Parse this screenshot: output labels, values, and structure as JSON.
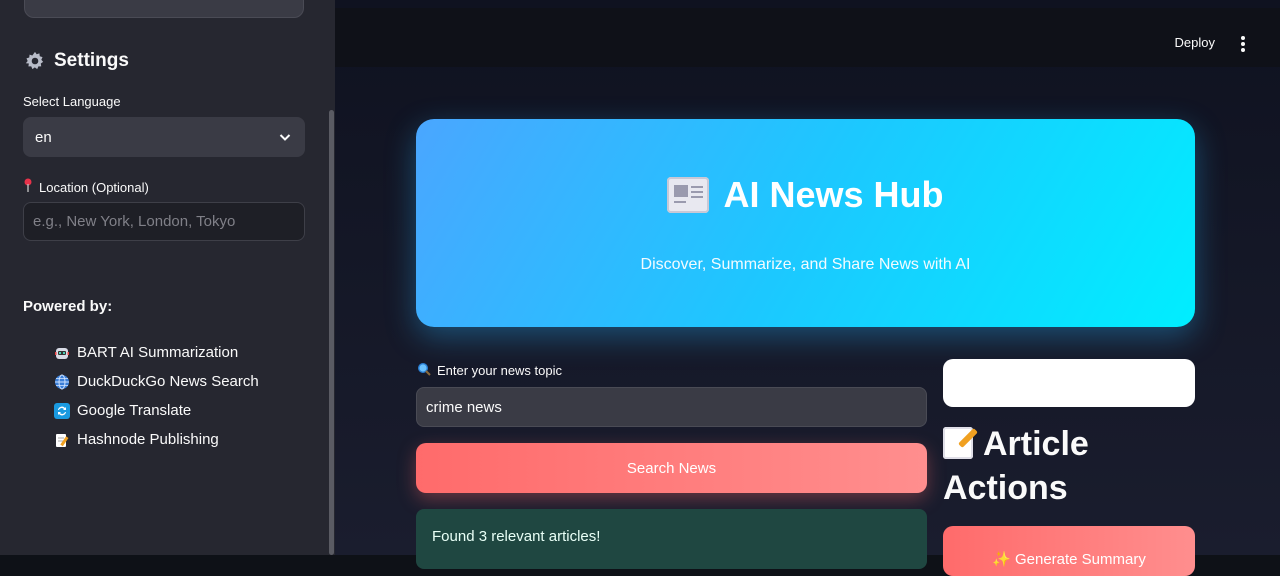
{
  "sidebar": {
    "header": "Settings",
    "language_label": "Select Language",
    "language_value": "en",
    "location_label": "Location (Optional)",
    "location_placeholder": "e.g., New York, London, Tokyo",
    "powered_label": "Powered by:",
    "powered_items": [
      {
        "label": "BART AI Summarization",
        "icon": "robot-icon"
      },
      {
        "label": "DuckDuckGo News Search",
        "icon": "globe-icon"
      },
      {
        "label": "Google Translate",
        "icon": "translate-icon"
      },
      {
        "label": "Hashnode Publishing",
        "icon": "memo-icon"
      }
    ]
  },
  "topbar": {
    "deploy_label": "Deploy"
  },
  "hero": {
    "title": "AI News Hub",
    "subtitle": "Discover, Summarize, and Share News with AI"
  },
  "search": {
    "label": "Enter your news topic",
    "value": "crime news",
    "button_label": "Search News",
    "result_text": "Found 3 relevant articles!"
  },
  "actions": {
    "title": "Article Actions",
    "generate_label": "✨ Generate Summary"
  },
  "colors": {
    "accent": "#ff6b6b",
    "hero_start": "#4aa6ff",
    "hero_end": "#00eeff",
    "success_bg": "#1f4741"
  }
}
